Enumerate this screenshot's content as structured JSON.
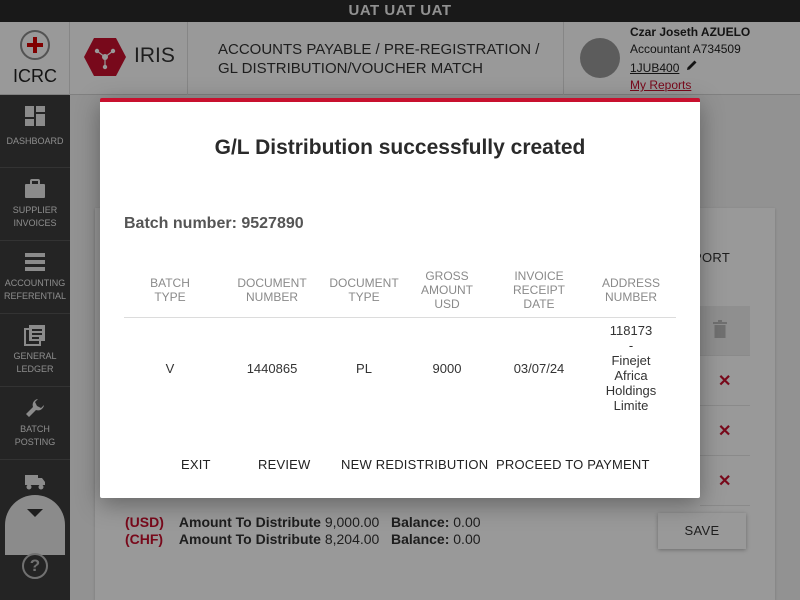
{
  "env_banner": "UAT UAT UAT",
  "header": {
    "org_name": "ICRC",
    "app_name": "IRIS",
    "breadcrumb_line1": "ACCOUNTS PAYABLE / PRE-REGISTRATION /",
    "breadcrumb_line2": "GL DISTRIBUTION/VOUCHER MATCH",
    "user": {
      "name": "Czar Joseth AZUELO",
      "role": "Accountant A734509",
      "code": "1JUB400",
      "reports_link": "My Reports"
    }
  },
  "sidebar": {
    "items": [
      {
        "line1": "DASHBOARD",
        "line2": "",
        "icon": "dashboard-icon"
      },
      {
        "line1": "SUPPLIER",
        "line2": "INVOICES",
        "icon": "briefcase-icon"
      },
      {
        "line1": "ACCOUNTING",
        "line2": "REFERENTIAL",
        "icon": "list-icon"
      },
      {
        "line1": "GENERAL",
        "line2": "LEDGER",
        "icon": "ledger-icon"
      },
      {
        "line1": "BATCH",
        "line2": "POSTING",
        "icon": "wrench-icon"
      }
    ],
    "help_icon": "?"
  },
  "background": {
    "export_label": "PORT",
    "totals": [
      {
        "currency": "(USD)",
        "label": "Amount To Distribute",
        "amount": "9,000.00",
        "balance_label": "Balance:",
        "balance": "0.00"
      },
      {
        "currency": "(CHF)",
        "label": "Amount To Distribute",
        "amount": "8,204.00",
        "balance_label": "Balance:",
        "balance": "0.00"
      }
    ],
    "save_label": "SAVE"
  },
  "modal": {
    "title": "G/L Distribution successfully created",
    "batch_label": "Batch number:",
    "batch_number": "9527890",
    "columns": [
      {
        "l1": "BATCH",
        "l2": "TYPE",
        "l3": ""
      },
      {
        "l1": "DOCUMENT",
        "l2": "NUMBER",
        "l3": ""
      },
      {
        "l1": "DOCUMENT",
        "l2": "TYPE",
        "l3": ""
      },
      {
        "l1": "GROSS",
        "l2": "AMOUNT",
        "l3": "USD"
      },
      {
        "l1": "INVOICE",
        "l2": "RECEIPT",
        "l3": "DATE"
      },
      {
        "l1": "ADDRESS",
        "l2": "NUMBER",
        "l3": ""
      }
    ],
    "row": {
      "batch_type": "V",
      "document_number": "1440865",
      "document_type": "PL",
      "gross_amount": "9000",
      "invoice_date": "03/07/24",
      "address_lines": [
        "118173",
        "-",
        "Finejet",
        "Africa",
        "Holdings",
        "Limite"
      ]
    },
    "actions": {
      "exit": "EXIT",
      "review": "REVIEW",
      "new_redistribution": "NEW REDISTRIBUTION",
      "proceed": "PROCEED TO PAYMENT"
    }
  }
}
